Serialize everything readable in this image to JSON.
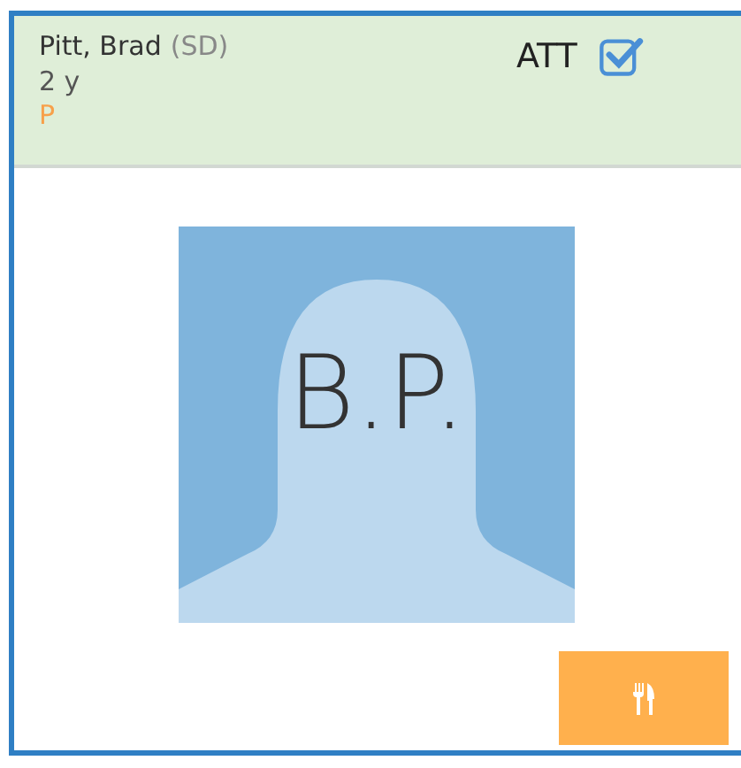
{
  "header": {
    "name": "Pitt, Brad",
    "code": "(SD)",
    "age": "2 y",
    "status": "P",
    "attendance": {
      "label": "ATT",
      "checked": true
    }
  },
  "avatar": {
    "initials": "B.P."
  },
  "buttons": [
    {
      "kind": "meal"
    }
  ]
}
